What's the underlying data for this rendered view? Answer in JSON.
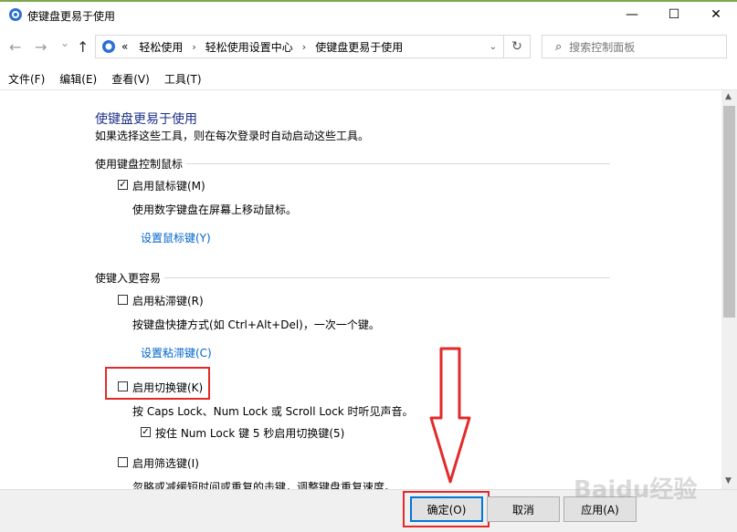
{
  "window": {
    "title": "使键盘更易于使用",
    "minimize": "—",
    "maximize": "☐",
    "close": "✕"
  },
  "nav": {
    "back": "←",
    "forward": "→",
    "recent": "⌄",
    "up": "↑",
    "address": {
      "prefix": "«",
      "crumbs": [
        "轻松使用",
        "轻松使用设置中心",
        "使键盘更易于使用"
      ]
    },
    "search_placeholder": "搜索控制面板"
  },
  "menu": [
    "文件(F)",
    "编辑(E)",
    "查看(V)",
    "工具(T)"
  ],
  "page": {
    "heading": "使键盘更易于使用",
    "description": "如果选择这些工具，则在每次登录时自动启动这些工具。",
    "sections": [
      {
        "title": "使用键盘控制鼠标",
        "options": [
          {
            "label": "启用鼠标键(M)",
            "checked": true,
            "note": "使用数字键盘在屏幕上移动鼠标。",
            "link": "设置鼠标键(Y)"
          }
        ]
      },
      {
        "title": "使键入更容易",
        "options": [
          {
            "label": "启用粘滞键(R)",
            "checked": false,
            "note": "按键盘快捷方式(如 Ctrl+Alt+Del)，一次一个键。",
            "link": "设置粘滞键(C)"
          },
          {
            "label": "启用切换键(K)",
            "checked": false,
            "note": "按 Caps Lock、Num Lock 或 Scroll Lock 时听见声音。",
            "sub": {
              "label": "按住 Num Lock 键 5 秒启用切换键(5)",
              "checked": true
            }
          },
          {
            "label": "启用筛选键(I)",
            "checked": false,
            "note": "忽略或减缓短时间或重复的击键，调整键盘重复速度。"
          }
        ]
      }
    ]
  },
  "buttons": {
    "ok": "确定(O)",
    "cancel": "取消",
    "apply": "应用(A)"
  },
  "watermark": "Baidu经验",
  "colors": {
    "highlight": "#e32a2a",
    "link": "#0066cc",
    "heading": "#1e3287"
  }
}
